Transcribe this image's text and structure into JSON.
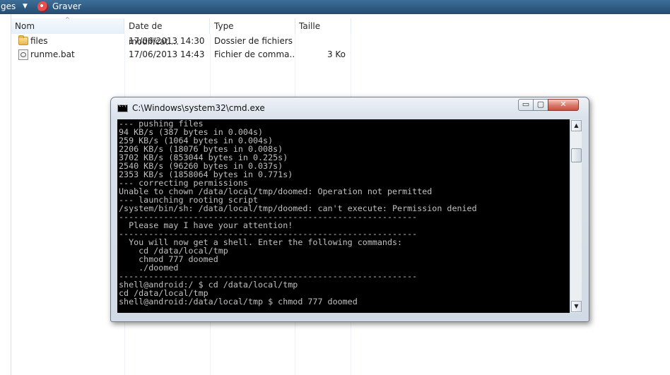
{
  "toolbar": {
    "left_label": "ges",
    "dropdown_arrow": "▼",
    "burn_label": "Graver"
  },
  "columns": {
    "name": "Nom",
    "date": "Date de modificati...",
    "type": "Type",
    "size": "Taille",
    "sort_indicator": "^"
  },
  "files": [
    {
      "icon": "folder-icon",
      "name": "files",
      "date": "17/06/2013 14:30",
      "type": "Dossier de fichiers",
      "size": ""
    },
    {
      "icon": "batch-file-icon",
      "name": "runme.bat",
      "date": "17/06/2013 14:43",
      "type": "Fichier de comma...",
      "size": "3 Ko"
    }
  ],
  "cmd_window": {
    "title": "C:\\Windows\\system32\\cmd.exe",
    "minimize": "▭",
    "maximize": "▢",
    "close": "✕",
    "console_lines": [
      "--- pushing files",
      "94 KB/s (387 bytes in 0.004s)",
      "259 KB/s (1064 bytes in 0.004s)",
      "2206 KB/s (18076 bytes in 0.008s)",
      "3702 KB/s (853044 bytes in 0.225s)",
      "2540 KB/s (96260 bytes in 0.037s)",
      "2353 KB/s (1858064 bytes in 0.771s)",
      "--- correcting permissions",
      "Unable to chown /data/local/tmp/doomed: Operation not permitted",
      "--- launching rooting script",
      "/system/bin/sh: /data/local/tmp/doomed: can't execute: Permission denied",
      "------------------------------------------------------------",
      "  Please may I have your attention!",
      "------------------------------------------------------------",
      "  You will now get a shell. Enter the following commands:",
      "    cd /data/local/tmp",
      "    chmod 777 doomed",
      "    ./doomed",
      "------------------------------------------------------------",
      "shell@android:/ $ cd /data/local/tmp",
      "cd /data/local/tmp",
      "shell@android:/data/local/tmp $ chmod 777 doomed"
    ],
    "scroll_up": "▲",
    "scroll_down": "▼"
  }
}
